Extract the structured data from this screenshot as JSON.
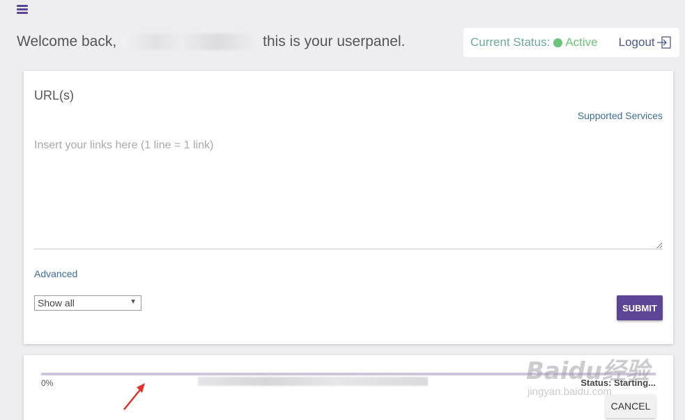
{
  "header": {
    "menu_icon": "hamburger-menu-icon",
    "welcome_prefix": "Welcome back,",
    "welcome_suffix": "this is your userpanel.",
    "status_label": "Current Status:",
    "status_value": "Active",
    "status_color": "#6cc278",
    "logout_label": "Logout",
    "logout_icon": "logout-arrow-icon"
  },
  "form": {
    "title": "URL(s)",
    "supported_link": "Supported Services",
    "links_placeholder": "Insert your links here (1 line = 1 link)",
    "links_value": "",
    "advanced_link": "Advanced",
    "filter_selected": "Show all",
    "submit_label": "SUBMIT"
  },
  "task": {
    "progress_label": "0%",
    "progress_fraction": 0,
    "status_text": "Status: Starting...",
    "cancel_label": "CANCEL"
  },
  "watermark": {
    "main": "Baidu经验",
    "sub": "jingyan.baidu.com"
  },
  "colors": {
    "accent": "#5d4596",
    "link": "#3b6b9a",
    "background": "#eeeef1"
  }
}
